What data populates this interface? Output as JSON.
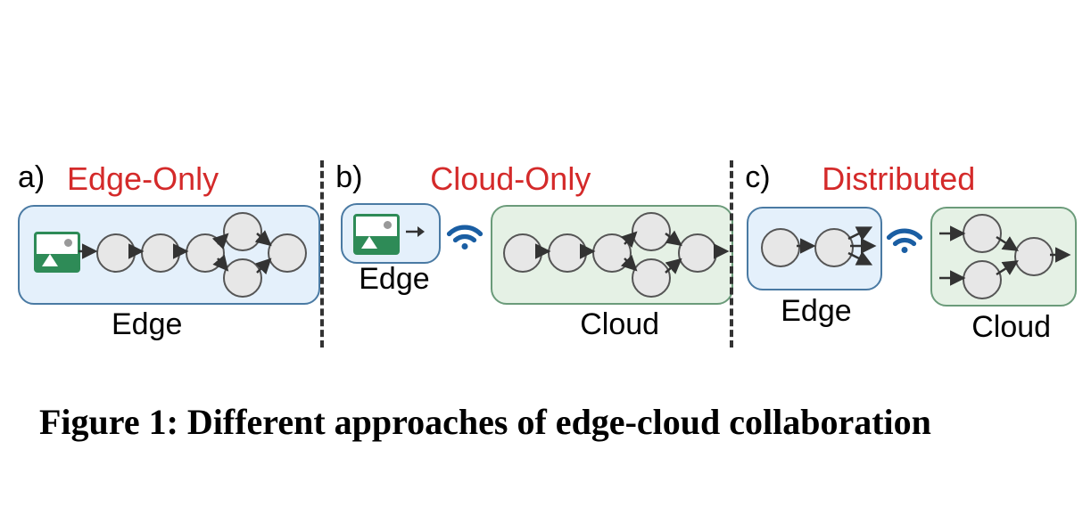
{
  "figure": {
    "caption": "Figure 1: Different approaches of edge-cloud collaboration",
    "panels": {
      "a": {
        "label": "a)",
        "title": "Edge-Only",
        "edge_caption": "Edge"
      },
      "b": {
        "label": "b)",
        "title": "Cloud-Only",
        "edge_caption": "Edge",
        "cloud_caption": "Cloud"
      },
      "c": {
        "label": "c)",
        "title": "Distributed",
        "edge_caption": "Edge",
        "cloud_caption": "Cloud"
      }
    },
    "icons": {
      "image": "image-icon",
      "wifi": "wifi-icon",
      "node": "nn-node",
      "arrow": "arrow-icon"
    }
  }
}
